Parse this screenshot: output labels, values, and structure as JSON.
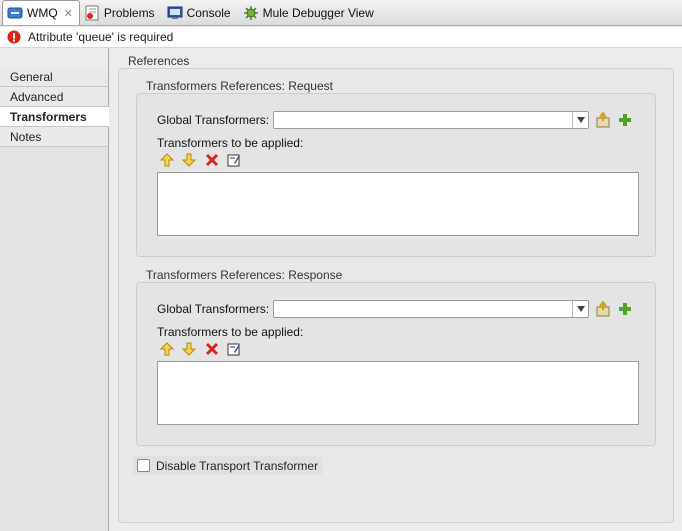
{
  "tabs": [
    {
      "label": "WMQ",
      "icon": "connector-icon",
      "active": true
    },
    {
      "label": "Problems",
      "icon": "problems-icon"
    },
    {
      "label": "Console",
      "icon": "console-icon"
    },
    {
      "label": "Mule Debugger View",
      "icon": "debugger-icon"
    }
  ],
  "error": {
    "message": "Attribute 'queue' is required",
    "icon": "error-icon",
    "color": "#d9261c"
  },
  "nav": {
    "items": [
      "General",
      "Advanced",
      "Transformers",
      "Notes"
    ],
    "active": "Transformers"
  },
  "references": {
    "title": "References",
    "request": {
      "title": "Transformers References: Request",
      "global_label": "Global Transformers:",
      "global_value": "",
      "applied_label": "Transformers to be applied:"
    },
    "response": {
      "title": "Transformers References: Response",
      "global_label": "Global Transformers:",
      "global_value": "",
      "applied_label": "Transformers to be applied:"
    }
  },
  "disable_transport": {
    "label": "Disable Transport Transformer",
    "checked": false
  }
}
